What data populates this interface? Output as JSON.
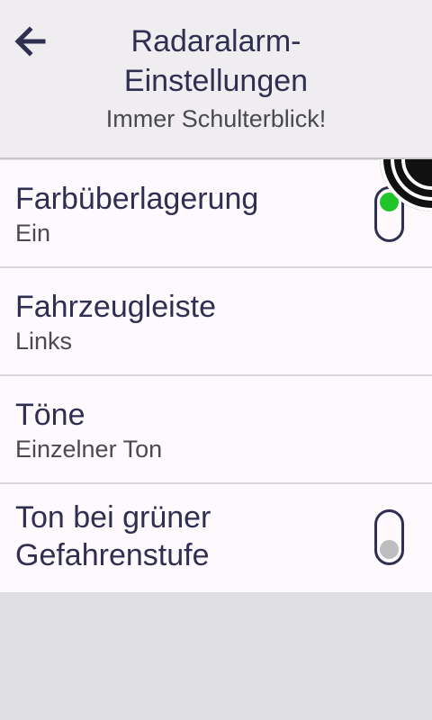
{
  "header": {
    "title": "Radaralarm-Einstellungen",
    "subtitle": "Immer Schulterblick!",
    "back_icon": "arrow-left-icon"
  },
  "settings": [
    {
      "title": "Farbüberlagerung",
      "value": "Ein",
      "toggle": true,
      "toggle_state": "on"
    },
    {
      "title": "Fahrzeugleiste",
      "value": "Links",
      "toggle": false
    },
    {
      "title": "Töne",
      "value": "Einzelner Ton",
      "toggle": false
    },
    {
      "title": "Ton bei grüner Gefahrenstufe",
      "toggle": true,
      "toggle_state": "off"
    }
  ],
  "colors": {
    "accent_on": "#20c629",
    "knob_off": "#bdbdbf",
    "text_primary": "#2f2f52",
    "header_bg": "#efedef",
    "row_bg": "#fdf9fd"
  },
  "corner_icon": "radar-signal-icon"
}
